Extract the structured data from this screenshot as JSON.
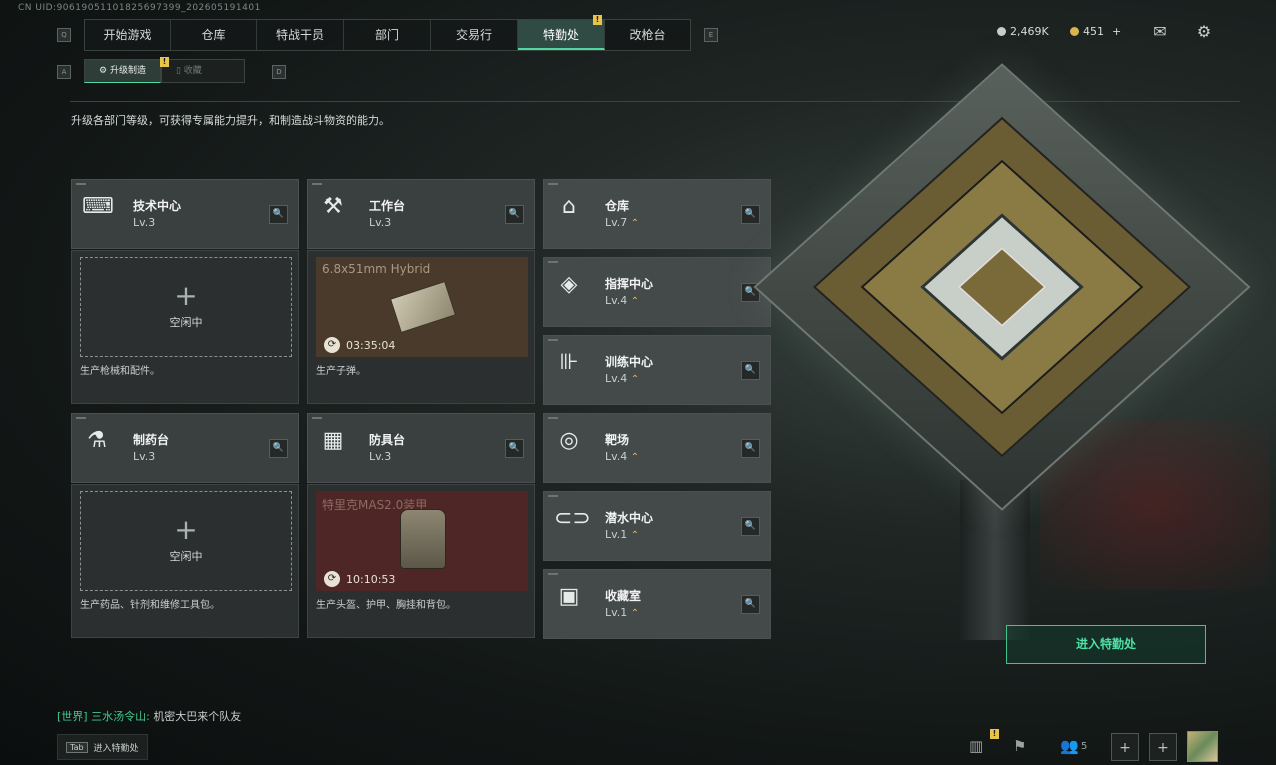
{
  "uid": "CN UID:90619051101825697399_202605191401",
  "nav": {
    "key_left": "Q",
    "key_right": "E",
    "tabs": [
      "开始游戏",
      "仓库",
      "特战干员",
      "部门",
      "交易行",
      "特勤处",
      "改枪台"
    ],
    "active_tab": "特勤处",
    "badge": "!"
  },
  "subnav": {
    "key_left": "A",
    "key_right": "D",
    "tabs": [
      "升级制造",
      "收藏"
    ],
    "badge": "!"
  },
  "currency": {
    "silver": "2,469K",
    "gold": "451",
    "gold_add": "+"
  },
  "description": "升级各部门等级，可获得专属能力提升，和制造战斗物资的能力。",
  "left_columns": [
    {
      "name": "技术中心",
      "level": "Lv.3",
      "icon": "tech-center-icon",
      "production": {
        "status": "idle",
        "plus": "+",
        "idle_label": "空闲中",
        "footer": "生产枪械和配件。"
      }
    },
    {
      "name": "工作台",
      "level": "Lv.3",
      "icon": "workbench-icon",
      "production": {
        "status": "busy",
        "item": "6.8x51mm Hybrid",
        "timer": "03:35:04",
        "footer": "生产子弹。",
        "bg": "#4a3a2c"
      }
    },
    {
      "name": "制药台",
      "level": "Lv.3",
      "icon": "pharmacy-icon",
      "production": {
        "status": "idle",
        "plus": "+",
        "idle_label": "空闲中",
        "footer": "生产药品、针剂和维修工具包。"
      }
    },
    {
      "name": "防具台",
      "level": "Lv.3",
      "icon": "armor-bench-icon",
      "production": {
        "status": "busy",
        "item": "特里克MAS2.0装甲",
        "timer": "10:10:53",
        "footer": "生产头盔、护甲、胸挂和背包。",
        "bg": "#4f2626"
      }
    }
  ],
  "right_column": [
    {
      "name": "仓库",
      "level": "Lv.7",
      "upgradable": true,
      "icon": "warehouse-icon"
    },
    {
      "name": "指挥中心",
      "level": "Lv.4",
      "upgradable": true,
      "icon": "command-center-icon"
    },
    {
      "name": "训练中心",
      "level": "Lv.4",
      "upgradable": true,
      "icon": "training-center-icon"
    },
    {
      "name": "靶场",
      "level": "Lv.4",
      "upgradable": true,
      "icon": "shooting-range-icon"
    },
    {
      "name": "潜水中心",
      "level": "Lv.1",
      "upgradable": true,
      "icon": "diving-center-icon"
    },
    {
      "name": "收藏室",
      "level": "Lv.1",
      "upgradable": true,
      "icon": "collection-room-icon"
    }
  ],
  "upgrade_glyph": "⌃",
  "enter_button": "进入特勤处",
  "chat": {
    "channel": "[世界]",
    "user": "三水汤令山:",
    "message": "机密大巴来个队友"
  },
  "tab_hint": {
    "key": "Tab",
    "label": "进入特勤处"
  },
  "bottom_bar": {
    "badge": "!",
    "friends_count": "5",
    "add": "+"
  },
  "colors": {
    "accent": "#4fd9a2",
    "upgrade": "#e3b94a",
    "badge": "#e8c44a"
  }
}
